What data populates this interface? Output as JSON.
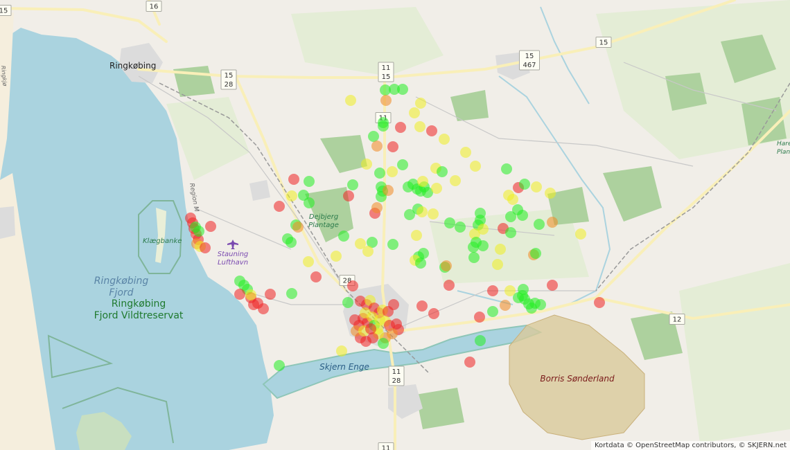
{
  "labels": {
    "ringkobing": "Ringkøbing",
    "kleegbanke": "Klægbanke",
    "ringkobing_fjord_1": "Ringkøbing",
    "ringkobing_fjord_2": "Fjord",
    "vildtreservat_1": "Ringkøbing",
    "vildtreservat_2": "Fjord Vildtreservat",
    "dejbjerg_1": "Dejbjerg",
    "dejbjerg_2": "Plantage",
    "stauning_1": "Stauning",
    "stauning_2": "Lufthavn",
    "skjern_enge": "Skjern Enge",
    "borris": "Borris Sønderland",
    "region_m": "Region M",
    "ringvej": "Ringkjø",
    "hare_1": "Hare",
    "hare_2": "Plant"
  },
  "road_shields": [
    {
      "id": "r15a",
      "lines": [
        "15"
      ]
    },
    {
      "id": "r16",
      "lines": [
        "16"
      ]
    },
    {
      "id": "r15_28",
      "lines": [
        "15",
        "28"
      ]
    },
    {
      "id": "r11_15",
      "lines": [
        "11",
        "15"
      ]
    },
    {
      "id": "r11a",
      "lines": [
        "11"
      ]
    },
    {
      "id": "r15_467",
      "lines": [
        "15",
        "467"
      ]
    },
    {
      "id": "r15b",
      "lines": [
        "15"
      ]
    },
    {
      "id": "r28",
      "lines": [
        "28"
      ]
    },
    {
      "id": "r11_28",
      "lines": [
        "11",
        "28"
      ]
    },
    {
      "id": "r12",
      "lines": [
        "12"
      ]
    },
    {
      "id": "r11b",
      "lines": [
        "11"
      ]
    }
  ],
  "marker_colors": {
    "green": "#22ee22",
    "yellow": "#eeee22",
    "orange": "#f08a22",
    "red": "#ee2222"
  },
  "attribution": "Kortdata © OpenStreetMap contributors, © SKJERN.net"
}
